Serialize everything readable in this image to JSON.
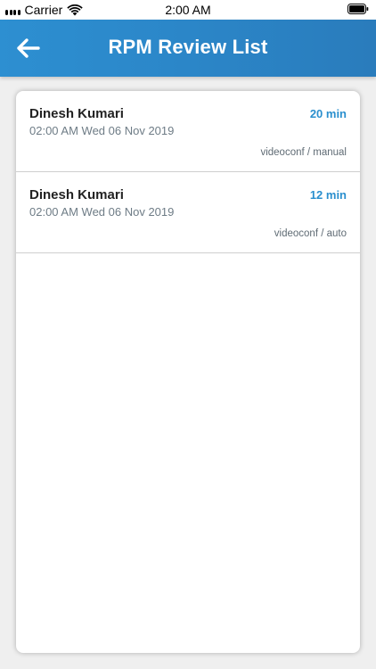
{
  "status_bar": {
    "carrier": "Carrier",
    "time": "2:00 AM"
  },
  "header": {
    "title": "RPM Review List",
    "accent_color": "#2b86c8"
  },
  "reviews": [
    {
      "name": "Dinesh Kumari",
      "datetime": "02:00 AM Wed 06 Nov 2019",
      "duration": "20 min",
      "type": "videoconf / manual"
    },
    {
      "name": "Dinesh Kumari",
      "datetime": "02:00 AM Wed 06 Nov 2019",
      "duration": "12 min",
      "type": "videoconf / auto"
    }
  ]
}
